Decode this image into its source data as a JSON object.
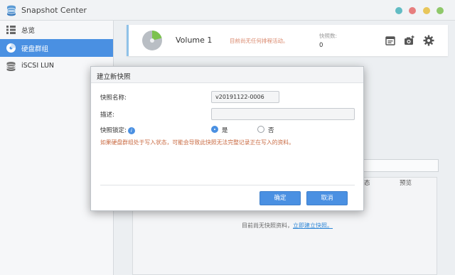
{
  "app": {
    "title": "Snapshot Center",
    "window_buttons": [
      "#62bcc4",
      "#e77e7e",
      "#e8c65a",
      "#8fc86a"
    ]
  },
  "sidebar": {
    "items": [
      {
        "label": "总览",
        "icon": "overview-list-icon"
      },
      {
        "label": "硬盘群组",
        "icon": "disk-group-icon",
        "active": true
      },
      {
        "label": "iSCSI LUN",
        "icon": "iscsi-lun-icon"
      }
    ]
  },
  "volume": {
    "name": "Volume 1",
    "status": "目前尚无任何排程活动。",
    "snapshot_count_label": "快照数:",
    "snapshot_count": "0",
    "tools": [
      "schedule-icon",
      "take-snapshot-icon",
      "settings-gear-icon"
    ]
  },
  "background": {
    "columns": [
      "态",
      "预览"
    ],
    "empty_text": "目前尚无快照资料，",
    "empty_link": "立即建立快照。"
  },
  "dialog": {
    "title": "建立新快照",
    "name_label": "快照名称:",
    "name_value": "v20191122-0006",
    "desc_label": "描述:",
    "desc_value": "",
    "lock_label": "快照锁定:",
    "lock_yes": "是",
    "lock_no": "否",
    "warning": "如果硬盘群组处于写入状态，可能会导致此快照无法完整记录正在写入的资料。",
    "ok": "确定",
    "cancel": "取消"
  },
  "colors": {
    "accent": "#4a90e2",
    "warning_text": "#c96b43",
    "pie_used": "#7cc24e",
    "pie_free": "#b9bec4"
  }
}
